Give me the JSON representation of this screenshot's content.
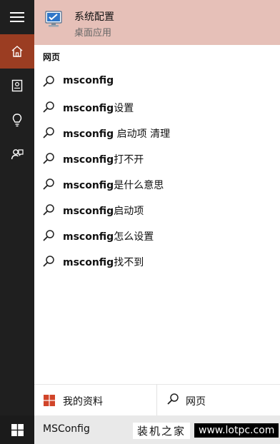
{
  "rail": {
    "items": [
      {
        "icon": "hamburger-menu-icon"
      },
      {
        "icon": "home-icon",
        "active": true
      },
      {
        "icon": "notebook-icon"
      },
      {
        "icon": "lightbulb-icon"
      },
      {
        "icon": "feedback-icon"
      }
    ]
  },
  "best_match": {
    "title": "系统配置",
    "subtitle": "桌面应用",
    "icon": "system-configuration-icon"
  },
  "section_label": "网页",
  "suggestions": [
    {
      "bold": "msconfig",
      "rest": ""
    },
    {
      "bold": "msconfig",
      "rest": "设置"
    },
    {
      "bold": "msconfig",
      "rest": " 启动项 清理"
    },
    {
      "bold": "msconfig",
      "rest": "打不开"
    },
    {
      "bold": "msconfig",
      "rest": "是什么意思"
    },
    {
      "bold": "msconfig",
      "rest": "启动项"
    },
    {
      "bold": "msconfig",
      "rest": "怎么设置"
    },
    {
      "bold": "msconfig",
      "rest": "找不到"
    }
  ],
  "filters": {
    "my_info_label": "我的资料",
    "web_label": "网页"
  },
  "taskbar": {
    "query": "MSConfig",
    "watermark_cn": "装机之家",
    "watermark_url": "www.lotpc.com"
  },
  "colors": {
    "rail": "#1f1f1f",
    "active": "#9b3d22",
    "best_match_bg": "#e6c0b8",
    "windows_logo": "#d1452a"
  }
}
